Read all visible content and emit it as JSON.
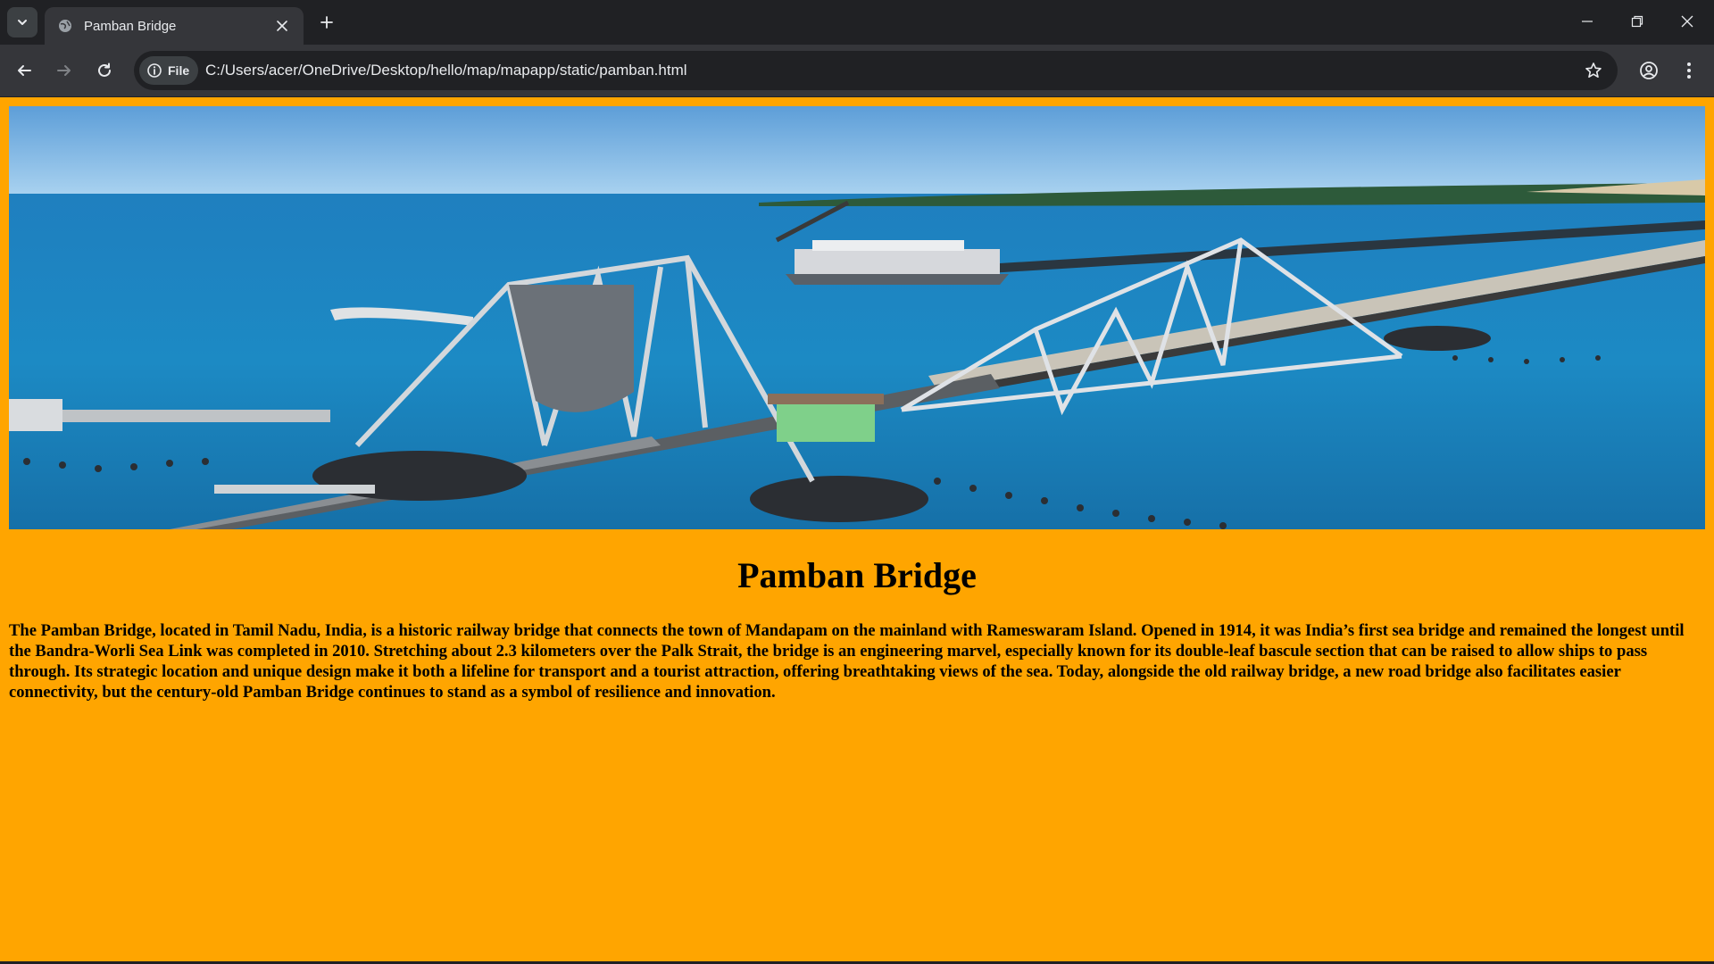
{
  "browser": {
    "tab_title": "Pamban Bridge",
    "site_chip_label": "File",
    "url": "C:/Users/acer/OneDrive/Desktop/hello/map/mapapp/static/pamban.html"
  },
  "page": {
    "background_color": "#ffa500",
    "hero_image_alt": "Pamban Bridge",
    "heading": "Pamban Bridge",
    "paragraph": "The Pamban Bridge, located in Tamil Nadu, India, is a historic railway bridge that connects the town of Mandapam on the mainland with Rameswaram Island. Opened in 1914, it was India’s first sea bridge and remained the longest until the Bandra-Worli Sea Link was completed in 2010. Stretching about 2.3 kilometers over the Palk Strait, the bridge is an engineering marvel, especially known for its double-leaf bascule section that can be raised to allow ships to pass through. Its strategic location and unique design make it both a lifeline for transport and a tourist attraction, offering breathtaking views of the sea. Today, alongside the old railway bridge, a new road bridge also facilitates easier connectivity, but the century-old Pamban Bridge continues to stand as a symbol of resilience and innovation."
  },
  "icons": {
    "tab_search": "chevron-down-icon",
    "favicon": "globe-icon",
    "tab_close": "close-icon",
    "new_tab": "plus-icon",
    "minimize": "minimize-icon",
    "restore": "restore-icon",
    "close_window": "close-icon",
    "back": "arrow-left-icon",
    "forward": "arrow-right-icon",
    "reload": "reload-icon",
    "site_info": "info-icon",
    "bookmark": "star-icon",
    "profile": "profile-icon",
    "menu": "more-vert-icon"
  }
}
